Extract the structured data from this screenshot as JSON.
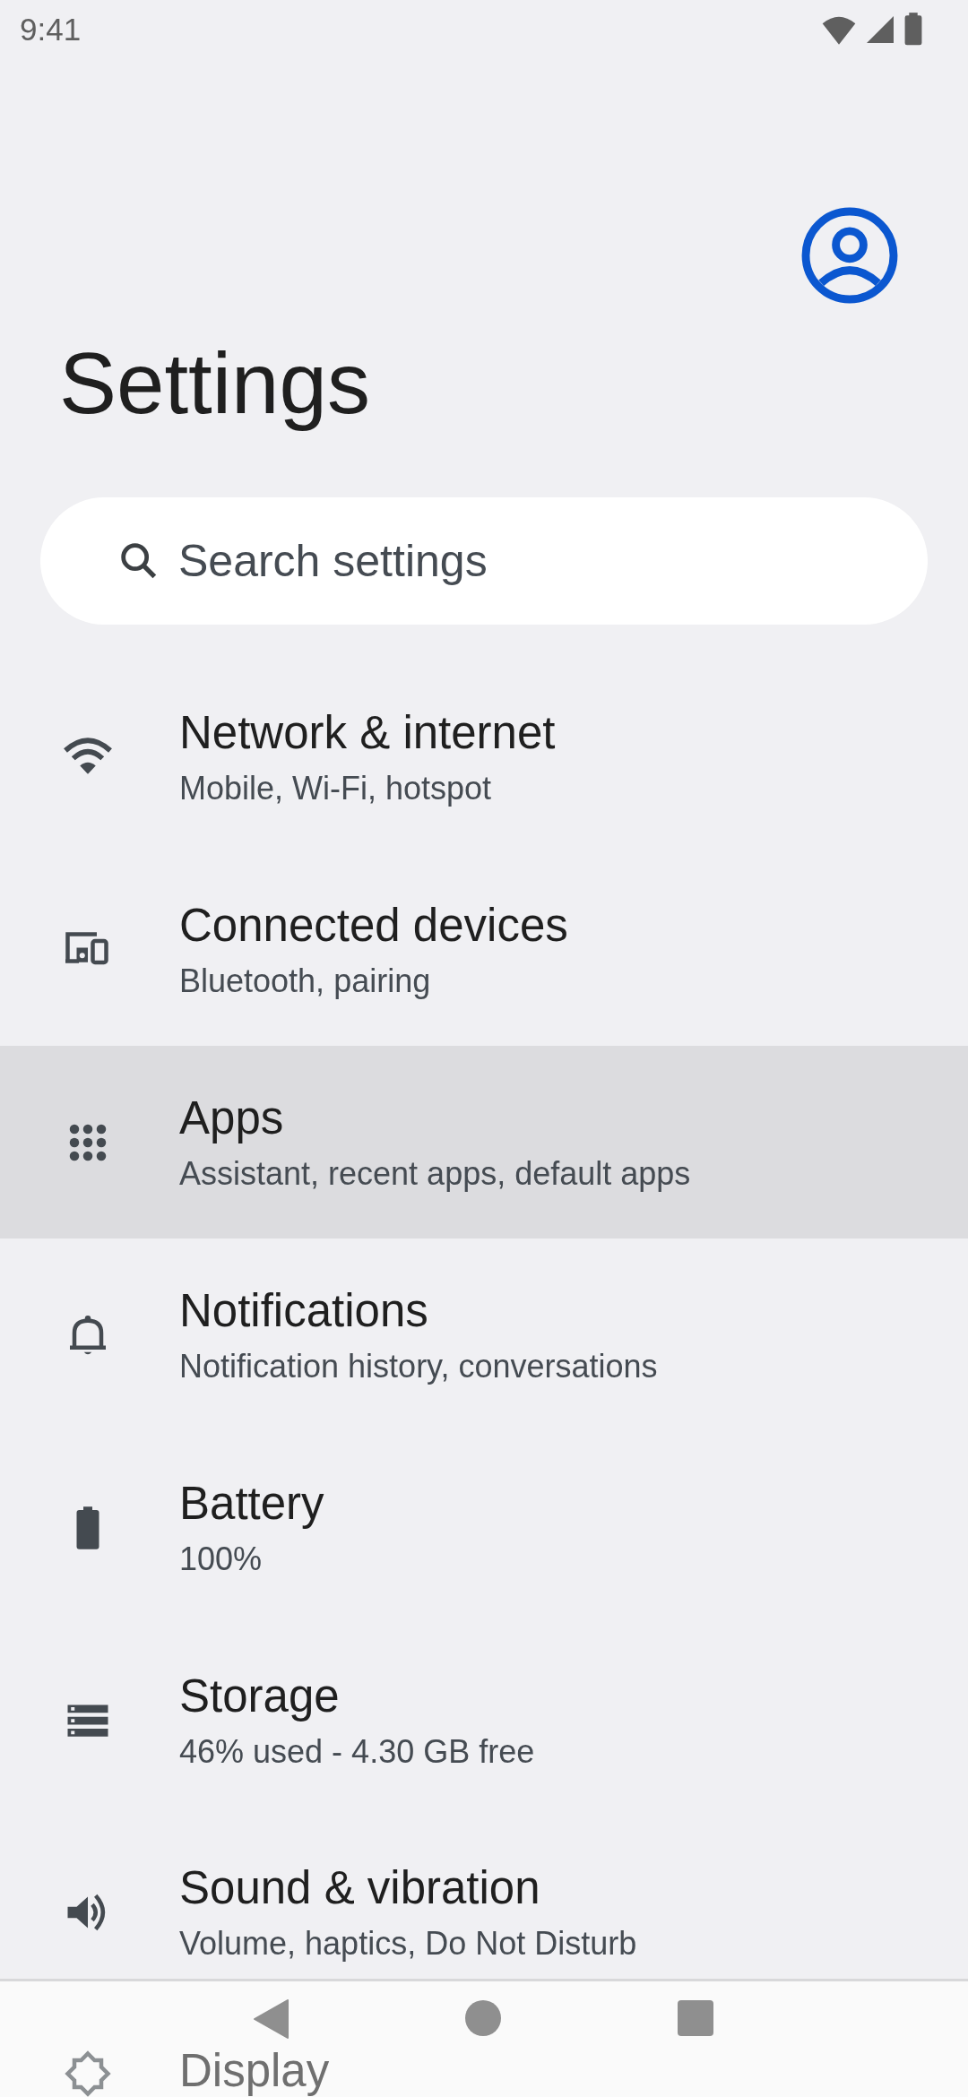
{
  "status_bar": {
    "time": "9:41"
  },
  "title": "Settings",
  "search": {
    "placeholder": "Search settings"
  },
  "items": [
    {
      "title": "Network & internet",
      "subtitle": "Mobile, Wi-Fi, hotspot",
      "selected": false
    },
    {
      "title": "Connected devices",
      "subtitle": "Bluetooth, pairing",
      "selected": false
    },
    {
      "title": "Apps",
      "subtitle": "Assistant, recent apps, default apps",
      "selected": true
    },
    {
      "title": "Notifications",
      "subtitle": "Notification history, conversations",
      "selected": false
    },
    {
      "title": "Battery",
      "subtitle": "100%",
      "selected": false
    },
    {
      "title": "Storage",
      "subtitle": "46% used - 4.30 GB free",
      "selected": false
    },
    {
      "title": "Sound & vibration",
      "subtitle": "Volume, haptics, Do Not Disturb",
      "selected": false
    },
    {
      "title": "Display",
      "selected": false
    }
  ]
}
